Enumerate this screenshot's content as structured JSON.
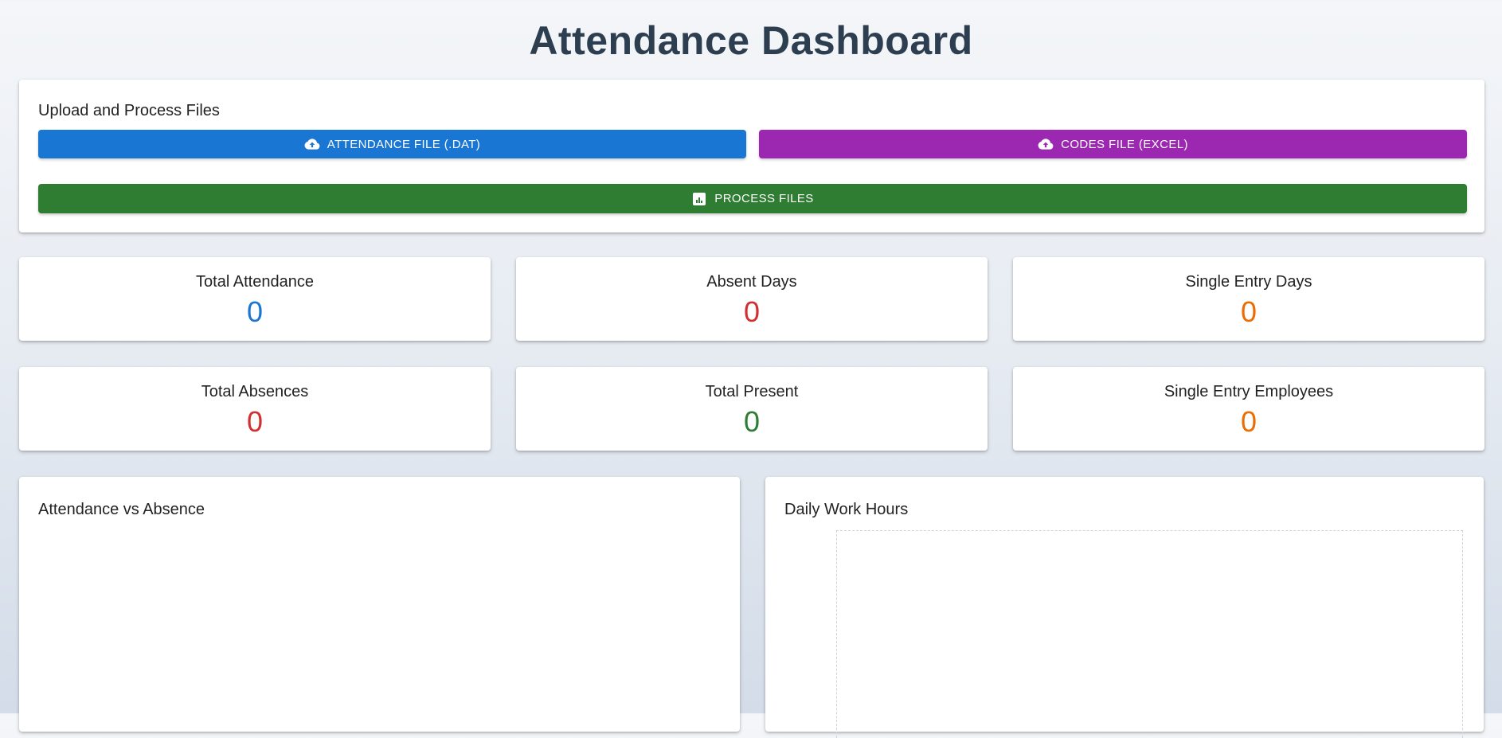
{
  "page": {
    "title": "Attendance Dashboard"
  },
  "upload": {
    "title": "Upload and Process Files",
    "attendance_button": {
      "label": "ATTENDANCE FILE (.DAT)",
      "icon": "cloud-upload-icon",
      "color": "#1976d2"
    },
    "codes_button": {
      "label": "CODES FILE (EXCEL)",
      "icon": "cloud-upload-icon",
      "color": "#9c27b0"
    },
    "process_button": {
      "label": "PROCESS FILES",
      "icon": "bar-chart-icon",
      "color": "#2e7d32"
    }
  },
  "stats": [
    {
      "label": "Total Attendance",
      "value": "0",
      "color": "#1976d2"
    },
    {
      "label": "Absent Days",
      "value": "0",
      "color": "#d32f2f"
    },
    {
      "label": "Single Entry Days",
      "value": "0",
      "color": "#ed6c02"
    },
    {
      "label": "Total Absences",
      "value": "0",
      "color": "#d32f2f"
    },
    {
      "label": "Total Present",
      "value": "0",
      "color": "#2e7d32"
    },
    {
      "label": "Single Entry Employees",
      "value": "0",
      "color": "#ed6c02"
    }
  ],
  "charts": {
    "attendance_vs_absence": {
      "title": "Attendance vs Absence"
    },
    "daily_work_hours": {
      "title": "Daily Work Hours"
    }
  }
}
